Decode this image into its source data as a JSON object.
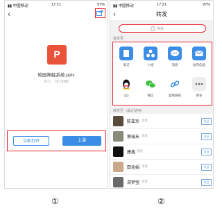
{
  "screen1": {
    "status": {
      "carrier": "▮▮ 中国移动",
      "time": "17:21",
      "battery": "97%"
    },
    "file_icon_letter": "P",
    "file_name": "校园神经系统.pptx",
    "size_label": "大小",
    "size_value": "28.26MB",
    "open_button": "立即打开",
    "class_button": "上课"
  },
  "screen2": {
    "status": {
      "carrier": "▮▮ 中国移动",
      "time": "17:21",
      "battery": "97%"
    },
    "title": "转发",
    "search_placeholder": "搜索",
    "section_forward": "转发至",
    "targets": [
      {
        "label": "笔记",
        "color": "#3b8de6"
      },
      {
        "label": "小组",
        "color": "#3b8de6"
      },
      {
        "label": "消息",
        "color": "#3b8de6"
      },
      {
        "label": "站内信函",
        "color": "#3b8de6"
      },
      {
        "label": "QQ",
        "color": "#ffffff"
      },
      {
        "label": "微信",
        "color": "#ffffff"
      },
      {
        "label": "复制链接",
        "color": "#ffffff"
      },
      {
        "label": "更多",
        "color": "#ffffff"
      }
    ],
    "section_recent": "转发至（最近使用）",
    "recent": [
      {
        "name": "陈亚玲",
        "tag": "消息",
        "send": "发送"
      },
      {
        "name": "蔡瑞东",
        "tag": "消息",
        "send": "发送"
      },
      {
        "name": "唐鑫",
        "tag": "消息",
        "send": "发送"
      },
      {
        "name": "田金娟",
        "tag": "消息",
        "send": "发送"
      },
      {
        "name": "郑梦莹",
        "tag": "消息",
        "send": "发送"
      }
    ]
  },
  "captions": [
    "①",
    "②"
  ]
}
